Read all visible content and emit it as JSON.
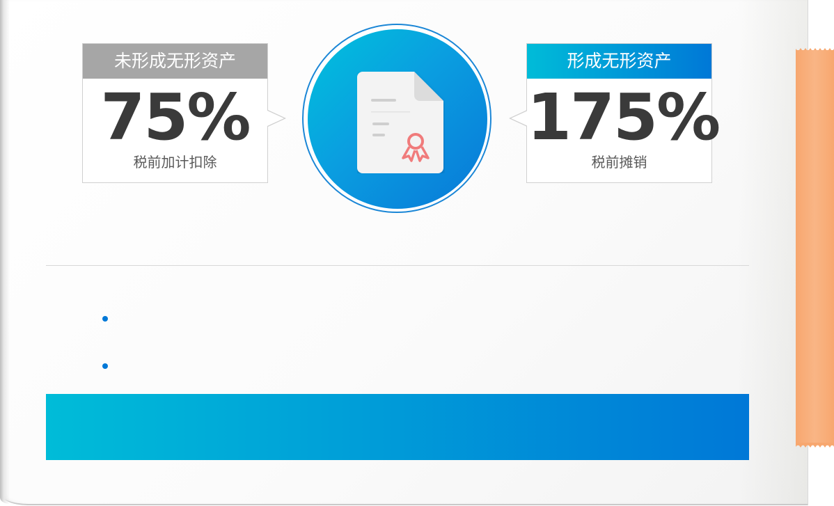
{
  "left_card": {
    "header": "未形成无形资产",
    "value": "75%",
    "caption": "税前加计扣除",
    "header_color": "#a6a6a6"
  },
  "right_card": {
    "header": "形成无形资产",
    "value": "175%",
    "caption": "税前摊销",
    "header_color_start": "#00bcd8",
    "header_color_end": "#0078d7"
  },
  "center_icon": "certificate-document-icon",
  "bullets": [
    "",
    ""
  ],
  "banner": {
    "text": ""
  },
  "colors": {
    "accent": "#0078d7",
    "accent_light": "#00bcd8",
    "tape": "#f7a76f",
    "value_text": "#3a3a3a"
  }
}
